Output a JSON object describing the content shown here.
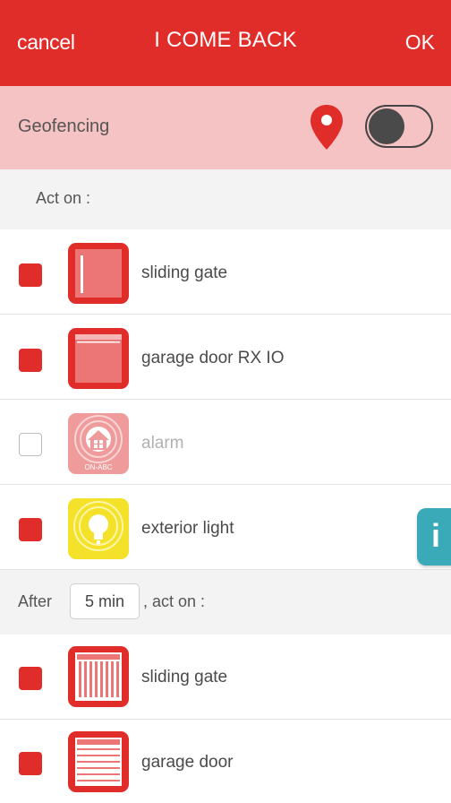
{
  "header": {
    "cancel_label": "cancel",
    "title": "I COME BACK",
    "ok_label": "OK"
  },
  "geofencing": {
    "label": "Geofencing",
    "enabled": false,
    "pin_icon": "location-pin-icon"
  },
  "section_act_on": {
    "label": "Act on :"
  },
  "devices": [
    {
      "label": "sliding gate",
      "checked": true,
      "icon": "sliding-gate-icon"
    },
    {
      "label": "garage door RX IO",
      "checked": true,
      "icon": "garage-door-icon"
    },
    {
      "label": "alarm",
      "checked": false,
      "icon": "alarm-house-icon",
      "icon_text": "ON-ABC"
    },
    {
      "label": "exterior light",
      "checked": true,
      "icon": "light-bulb-icon"
    }
  ],
  "section_after": {
    "prefix": "After",
    "delay_value": "5 min",
    "suffix": ", act on :"
  },
  "after_devices": [
    {
      "label": "sliding gate",
      "checked": true,
      "icon": "sliding-gate-open-icon"
    },
    {
      "label": "garage door",
      "checked": true,
      "icon": "garage-door-open-icon"
    }
  ],
  "info_tab": {
    "label": "i"
  },
  "colors": {
    "brand_red": "#e12d2a",
    "geofence_bg": "#f5c3c3",
    "light_yellow": "#f4e22a",
    "info_teal": "#3aaab8"
  }
}
